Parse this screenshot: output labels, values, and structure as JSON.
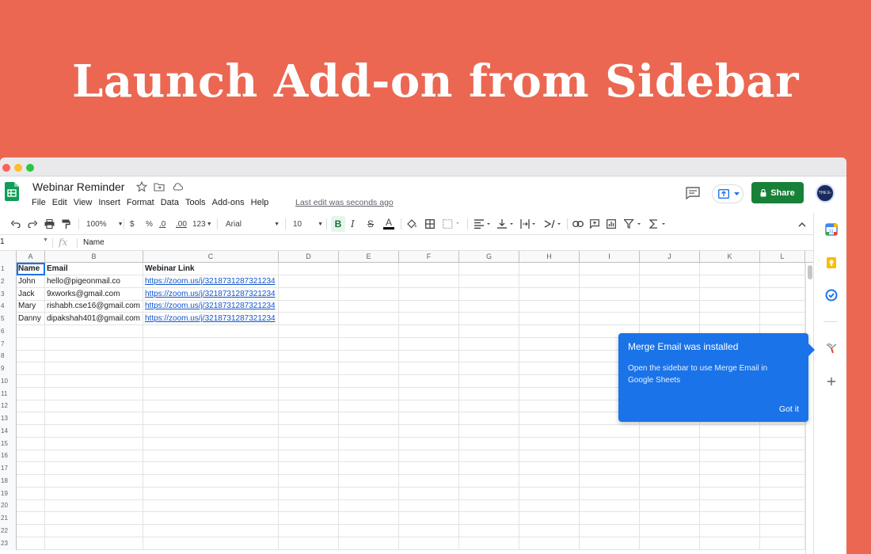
{
  "headline": "Launch Add-on from Sidebar",
  "doc": {
    "title": "Webinar Reminder",
    "menu": [
      "File",
      "Edit",
      "View",
      "Insert",
      "Format",
      "Data",
      "Tools",
      "Add-ons",
      "Help"
    ],
    "last_edit": "Last edit was seconds ago",
    "share_label": "Share",
    "avatar_text": "THE E-MAIL"
  },
  "toolbar": {
    "zoom": "100%",
    "currency": "$",
    "percent": "%",
    "dec_less": ".0",
    "dec_more": ".00",
    "format_more": "123",
    "font": "Arial",
    "font_size": "10",
    "bold": "B",
    "italic": "I",
    "strike": "S",
    "text_color": "A"
  },
  "formula_bar": {
    "cell_ref": "1",
    "fx": "fx",
    "value": "Name"
  },
  "grid": {
    "columns": [
      "A",
      "B",
      "C",
      "D",
      "E",
      "F",
      "G",
      "H",
      "I",
      "J",
      "K",
      "L"
    ],
    "row_numbers": [
      "1",
      "2",
      "3",
      "4",
      "5",
      "6",
      "7",
      "8",
      "9",
      "10",
      "11",
      "12",
      "13",
      "14",
      "15",
      "16",
      "17",
      "18",
      "19",
      "20",
      "21",
      "22",
      "23"
    ],
    "header": [
      "Name",
      "Email",
      "Webinar Link"
    ],
    "rows": [
      [
        "John",
        "hello@pigeonmail.co",
        "https://zoom.us/j/3218731287321234"
      ],
      [
        "Jack",
        "9xworks@gmail.com",
        "https://zoom.us/j/3218731287321234"
      ],
      [
        "Mary",
        "rishabh.cse16@gmail.com",
        "https://zoom.us/j/3218731287321234"
      ],
      [
        "Danny",
        "dipakshah401@gmail.com",
        "https://zoom.us/j/3218731287321234"
      ]
    ]
  },
  "popup": {
    "title": "Merge Email was installed",
    "body": "Open the sidebar to use Merge Email in Google Sheets",
    "button": "Got it"
  },
  "colors": {
    "background": "#EB6752",
    "share": "#188038",
    "popup": "#1a73e8",
    "link": "#1155cc"
  },
  "icons": [
    "undo-icon",
    "redo-icon",
    "print-icon",
    "paint-format-icon",
    "fill-color-icon",
    "borders-icon",
    "merge-icon",
    "align-icon",
    "valign-icon",
    "wrap-icon",
    "rotate-icon",
    "link-icon",
    "comment-icon",
    "chart-icon",
    "filter-icon",
    "functions-icon",
    "calendar-icon",
    "keep-icon",
    "tasks-icon",
    "addon-icon",
    "plus-icon"
  ]
}
